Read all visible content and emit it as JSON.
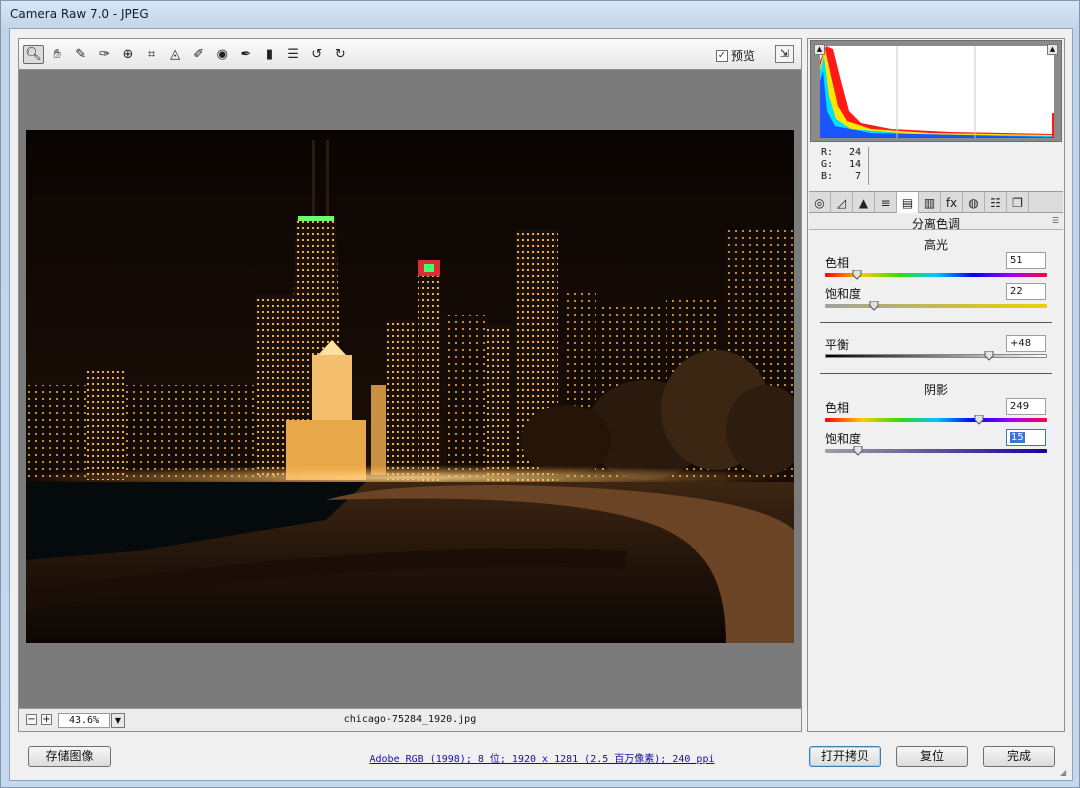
{
  "window": {
    "title": "Camera Raw 7.0 -  JPEG"
  },
  "toolbar": {
    "tools": [
      {
        "name": "zoom-tool-icon",
        "glyph": "🔍︎",
        "active": true
      },
      {
        "name": "hand-tool-icon",
        "glyph": "✋︎"
      },
      {
        "name": "white-balance-tool-icon",
        "glyph": "✎"
      },
      {
        "name": "color-sampler-tool-icon",
        "glyph": "✑"
      },
      {
        "name": "targeted-adjustment-tool-icon",
        "glyph": "⊕"
      },
      {
        "name": "crop-tool-icon",
        "glyph": "⌗"
      },
      {
        "name": "straighten-tool-icon",
        "glyph": "◬"
      },
      {
        "name": "spot-removal-tool-icon",
        "glyph": "✐"
      },
      {
        "name": "red-eye-removal-icon",
        "glyph": "◉"
      },
      {
        "name": "adjustment-brush-icon",
        "glyph": "✒"
      },
      {
        "name": "graduated-filter-icon",
        "glyph": "▮"
      },
      {
        "name": "preferences-icon",
        "glyph": "☰"
      },
      {
        "name": "rotate-left-icon",
        "glyph": "↺"
      },
      {
        "name": "rotate-right-icon",
        "glyph": "↻"
      }
    ],
    "preview_label": "预览",
    "preview_checked": "✓",
    "fullscreen_glyph": "⇲"
  },
  "status": {
    "zoom_out": "−",
    "zoom_in": "+",
    "zoom_value": "43.6%",
    "zoom_drop": "▼",
    "filename": "chicago-75284_1920.jpg"
  },
  "histogram": {
    "clip_shadow": "▲",
    "clip_highlight": "▲",
    "rgb": [
      {
        "k": "R:",
        "v": "24"
      },
      {
        "k": "G:",
        "v": "14"
      },
      {
        "k": "B:",
        "v": "7"
      }
    ]
  },
  "tabs": [
    {
      "name": "tab-basic",
      "glyph": "◎"
    },
    {
      "name": "tab-tone-curve",
      "glyph": "◿"
    },
    {
      "name": "tab-detail",
      "glyph": "▲"
    },
    {
      "name": "tab-hsl",
      "glyph": "≡"
    },
    {
      "name": "tab-split-toning",
      "glyph": "▤",
      "active": true
    },
    {
      "name": "tab-lens-corrections",
      "glyph": "▥"
    },
    {
      "name": "tab-effects",
      "glyph": "fx"
    },
    {
      "name": "tab-camera-calibration",
      "glyph": "◍"
    },
    {
      "name": "tab-presets",
      "glyph": "☷"
    },
    {
      "name": "tab-snapshots",
      "glyph": "❐"
    }
  ],
  "panel": {
    "title": "分离色调",
    "menu_glyph": "☰",
    "highlights": {
      "heading": "高光",
      "hue": {
        "label": "色相",
        "value": "51",
        "fraction": 0.143
      },
      "saturation": {
        "label": "饱和度",
        "value": "22",
        "fraction": 0.22
      }
    },
    "balance": {
      "label": "平衡",
      "value": "+48",
      "fraction": 0.74
    },
    "shadows": {
      "heading": "阴影",
      "hue": {
        "label": "色相",
        "value": "249",
        "fraction": 0.692
      },
      "saturation": {
        "label": "饱和度",
        "value": "15",
        "fraction": 0.15
      }
    }
  },
  "bottom": {
    "save_label": "存储图像",
    "info_text": "Adobe RGB (1998); 8 位; 1920 x 1281 (2.5 百万像素); 240 ppi",
    "open_copy_label": "打开拷贝",
    "reset_label": "复位",
    "done_label": "完成"
  }
}
